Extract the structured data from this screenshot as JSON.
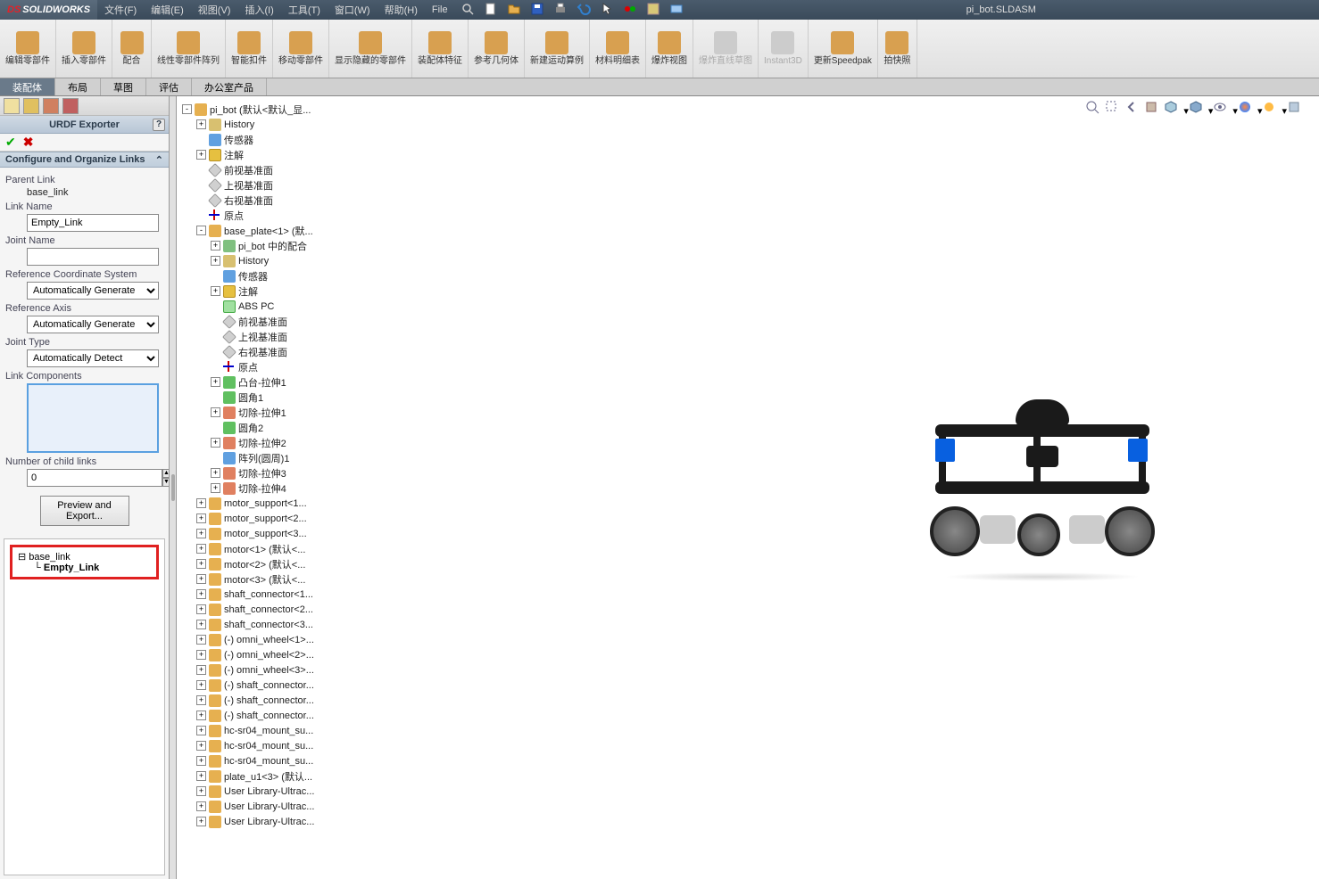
{
  "app": {
    "logo_prefix": "DS",
    "logo_name": "SOLIDWORKS",
    "filename": "pi_bot.SLDASM"
  },
  "menu": [
    "文件(F)",
    "编辑(E)",
    "视图(V)",
    "插入(I)",
    "工具(T)",
    "窗口(W)",
    "帮助(H)",
    "File"
  ],
  "ribbon": [
    {
      "label": "编辑零部件"
    },
    {
      "label": "插入零部件"
    },
    {
      "label": "配合"
    },
    {
      "label": "线性零部件阵列"
    },
    {
      "label": "智能扣件"
    },
    {
      "label": "移动零部件"
    },
    {
      "label": "显示隐藏的零部件"
    },
    {
      "label": "装配体特征"
    },
    {
      "label": "参考几何体"
    },
    {
      "label": "新建运动算例"
    },
    {
      "label": "材料明细表"
    },
    {
      "label": "爆炸视图"
    },
    {
      "label": "爆炸直线草图",
      "disabled": true
    },
    {
      "label": "Instant3D",
      "disabled": true
    },
    {
      "label": "更新Speedpak"
    },
    {
      "label": "拍快照"
    }
  ],
  "tabs": [
    {
      "label": "装配体",
      "active": true
    },
    {
      "label": "布局"
    },
    {
      "label": "草图"
    },
    {
      "label": "评估"
    },
    {
      "label": "办公室产品"
    }
  ],
  "exporter": {
    "title": "URDF Exporter",
    "section": "Configure and Organize Links",
    "parent_link_label": "Parent Link",
    "parent_link_value": "base_link",
    "link_name_label": "Link Name",
    "link_name_value": "Empty_Link",
    "joint_name_label": "Joint Name",
    "joint_name_value": "",
    "ref_coord_label": "Reference Coordinate System",
    "ref_coord_value": "Automatically Generate",
    "ref_axis_label": "Reference Axis",
    "ref_axis_value": "Automatically Generate",
    "joint_type_label": "Joint Type",
    "joint_type_value": "Automatically Detect",
    "link_comp_label": "Link Components",
    "num_child_label": "Number of child links",
    "num_child_value": "0",
    "preview_btn": "Preview and Export...",
    "tree_root": "base_link",
    "tree_child": "Empty_Link"
  },
  "ftree": [
    {
      "ind": 0,
      "exp": "-",
      "ico": "asm",
      "label": "pi_bot  (默认<默认_显..."
    },
    {
      "ind": 1,
      "exp": "+",
      "ico": "fold",
      "label": "History"
    },
    {
      "ind": 1,
      "exp": "",
      "ico": "sens",
      "label": "传感器"
    },
    {
      "ind": 1,
      "exp": "+",
      "ico": "ann",
      "label": "注解"
    },
    {
      "ind": 1,
      "exp": "",
      "ico": "plane",
      "label": "前视基准面"
    },
    {
      "ind": 1,
      "exp": "",
      "ico": "plane",
      "label": "上视基准面"
    },
    {
      "ind": 1,
      "exp": "",
      "ico": "plane",
      "label": "右视基准面"
    },
    {
      "ind": 1,
      "exp": "",
      "ico": "origin",
      "label": "原点"
    },
    {
      "ind": 1,
      "exp": "-",
      "ico": "part",
      "label": "base_plate<1>  (默..."
    },
    {
      "ind": 2,
      "exp": "+",
      "ico": "mate",
      "label": "pi_bot 中的配合"
    },
    {
      "ind": 2,
      "exp": "+",
      "ico": "fold",
      "label": "History"
    },
    {
      "ind": 2,
      "exp": "",
      "ico": "sens",
      "label": "传感器"
    },
    {
      "ind": 2,
      "exp": "+",
      "ico": "ann",
      "label": "注解"
    },
    {
      "ind": 2,
      "exp": "",
      "ico": "mat",
      "label": "ABS PC"
    },
    {
      "ind": 2,
      "exp": "",
      "ico": "plane",
      "label": "前视基准面"
    },
    {
      "ind": 2,
      "exp": "",
      "ico": "plane",
      "label": "上视基准面"
    },
    {
      "ind": 2,
      "exp": "",
      "ico": "plane",
      "label": "右视基准面"
    },
    {
      "ind": 2,
      "exp": "",
      "ico": "origin",
      "label": "原点"
    },
    {
      "ind": 2,
      "exp": "+",
      "ico": "feat",
      "label": "凸台-拉伸1"
    },
    {
      "ind": 2,
      "exp": "",
      "ico": "feat",
      "label": "圆角1"
    },
    {
      "ind": 2,
      "exp": "+",
      "ico": "cut",
      "label": "切除-拉伸1"
    },
    {
      "ind": 2,
      "exp": "",
      "ico": "feat",
      "label": "圆角2"
    },
    {
      "ind": 2,
      "exp": "+",
      "ico": "cut",
      "label": "切除-拉伸2"
    },
    {
      "ind": 2,
      "exp": "",
      "ico": "pat",
      "label": "阵列(圆周)1"
    },
    {
      "ind": 2,
      "exp": "+",
      "ico": "cut",
      "label": "切除-拉伸3"
    },
    {
      "ind": 2,
      "exp": "+",
      "ico": "cut",
      "label": "切除-拉伸4"
    },
    {
      "ind": 1,
      "exp": "+",
      "ico": "part",
      "label": "motor_support<1..."
    },
    {
      "ind": 1,
      "exp": "+",
      "ico": "part",
      "label": "motor_support<2..."
    },
    {
      "ind": 1,
      "exp": "+",
      "ico": "part",
      "label": "motor_support<3..."
    },
    {
      "ind": 1,
      "exp": "+",
      "ico": "part",
      "label": "motor<1>  (默认<..."
    },
    {
      "ind": 1,
      "exp": "+",
      "ico": "part",
      "label": "motor<2>  (默认<..."
    },
    {
      "ind": 1,
      "exp": "+",
      "ico": "part",
      "label": "motor<3>  (默认<..."
    },
    {
      "ind": 1,
      "exp": "+",
      "ico": "part",
      "label": "shaft_connector<1..."
    },
    {
      "ind": 1,
      "exp": "+",
      "ico": "part",
      "label": "shaft_connector<2..."
    },
    {
      "ind": 1,
      "exp": "+",
      "ico": "part",
      "label": "shaft_connector<3..."
    },
    {
      "ind": 1,
      "exp": "+",
      "ico": "part",
      "label": "(-) omni_wheel<1>..."
    },
    {
      "ind": 1,
      "exp": "+",
      "ico": "part",
      "label": "(-) omni_wheel<2>..."
    },
    {
      "ind": 1,
      "exp": "+",
      "ico": "part",
      "label": "(-) omni_wheel<3>..."
    },
    {
      "ind": 1,
      "exp": "+",
      "ico": "part",
      "label": "(-) shaft_connector..."
    },
    {
      "ind": 1,
      "exp": "+",
      "ico": "part",
      "label": "(-) shaft_connector..."
    },
    {
      "ind": 1,
      "exp": "+",
      "ico": "part",
      "label": "(-) shaft_connector..."
    },
    {
      "ind": 1,
      "exp": "+",
      "ico": "part",
      "label": "hc-sr04_mount_su..."
    },
    {
      "ind": 1,
      "exp": "+",
      "ico": "part",
      "label": "hc-sr04_mount_su..."
    },
    {
      "ind": 1,
      "exp": "+",
      "ico": "part",
      "label": "hc-sr04_mount_su..."
    },
    {
      "ind": 1,
      "exp": "+",
      "ico": "part",
      "label": "plate_u1<3>  (默认..."
    },
    {
      "ind": 1,
      "exp": "+",
      "ico": "part",
      "label": "User Library-Ultrac..."
    },
    {
      "ind": 1,
      "exp": "+",
      "ico": "part",
      "label": "User Library-Ultrac..."
    },
    {
      "ind": 1,
      "exp": "+",
      "ico": "part",
      "label": "User Library-Ultrac..."
    }
  ]
}
